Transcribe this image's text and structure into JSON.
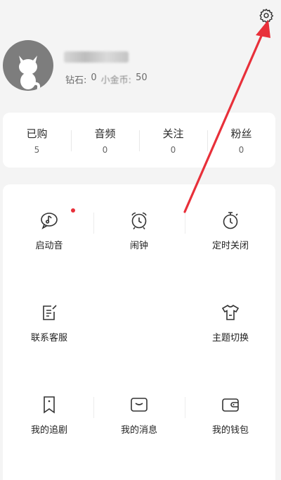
{
  "header": {
    "settings_icon": "gear-icon",
    "avatar_icon": "cat-avatar-icon",
    "diamond_label": "钻石:",
    "diamond_value": "0",
    "coin_label": "小金币:",
    "coin_value": "50"
  },
  "stats": [
    {
      "label": "已购",
      "count": "5"
    },
    {
      "label": "音频",
      "count": "0"
    },
    {
      "label": "关注",
      "count": "0"
    },
    {
      "label": "粉丝",
      "count": "0"
    }
  ],
  "grid": [
    {
      "label": "启动音",
      "icon": "music-bubble-icon",
      "has_badge": true
    },
    {
      "label": "闹钟",
      "icon": "alarm-clock-icon"
    },
    {
      "label": "定时关闭",
      "icon": "stopwatch-icon"
    },
    {
      "label": "联系客服",
      "icon": "edit-note-icon"
    },
    {
      "label": "主题切换",
      "icon": "tshirt-icon"
    },
    {
      "label": "我的追剧",
      "icon": "bookmark-icon"
    },
    {
      "label": "我的消息",
      "icon": "message-envelope-icon"
    },
    {
      "label": "我的钱包",
      "icon": "wallet-icon"
    }
  ],
  "colors": {
    "badge": "#e8303a",
    "annotation_arrow": "#e8303a",
    "avatar_bg": "#7d7d7d"
  }
}
